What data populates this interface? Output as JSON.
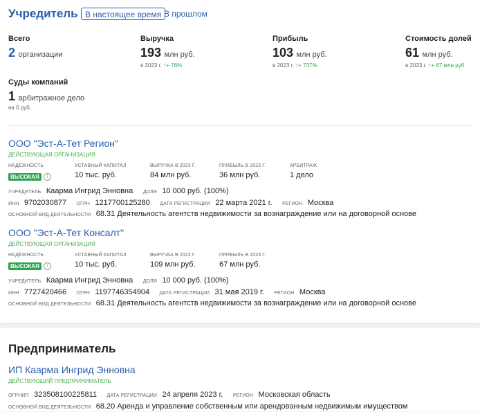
{
  "founder": {
    "title": "Учредитель",
    "tabs": [
      "В настоящее время",
      "В прошлом"
    ]
  },
  "summary": {
    "total": {
      "label": "Всего",
      "value": "2",
      "unit": "организации"
    },
    "revenue": {
      "label": "Выручка",
      "value": "193",
      "unit": "млн руб.",
      "year": "в 2023 г.",
      "change": "+ 76%"
    },
    "profit": {
      "label": "Прибыль",
      "value": "103",
      "unit": "млн руб.",
      "year": "в 2023 г.",
      "change": "+ 737%"
    },
    "share_value": {
      "label": "Стоимость долей",
      "value": "61",
      "unit": "млн руб.",
      "year": "в 2023 г.",
      "change": "+ 67 млн руб."
    },
    "courts": {
      "label": "Суды компаний",
      "value": "1",
      "unit": "арбитражное дело",
      "sub": "на 0 руб."
    }
  },
  "orgs": [
    {
      "name": "ООО \"Эст-А-Тет Регион\"",
      "status": "Действующая организация",
      "reliability_label": "Надёжность",
      "reliability": "Высокая",
      "capital_label": "Уставный капитал",
      "capital": "10 тыс. руб.",
      "revenue_label": "Выручка в 2023 г.",
      "revenue": "84 млн руб.",
      "profit_label": "Прибыль в 2023 г.",
      "profit": "36 млн руб.",
      "arb_label": "Арбитраж",
      "arb": "1 дело",
      "founder_label": "Учредитель",
      "founder": "Каарма Ингрид Энновна",
      "share_label": "Доля",
      "share": "10 000 руб. (100%)",
      "inn_label": "ИНН",
      "inn": "9702030877",
      "ogrn_label": "ОГРН",
      "ogrn": "1217700125280",
      "reg_label": "Дата регистрации",
      "reg": "22 марта 2021 г.",
      "region_label": "Регион",
      "region": "Москва",
      "activity_label": "Основной вид деятельности",
      "activity": "68.31 Деятельность агентств недвижимости за вознаграждение или на договорной основе"
    },
    {
      "name": "ООО \"Эст-А-Тет Консалт\"",
      "status": "Действующая организация",
      "reliability_label": "Надёжность",
      "reliability": "Высокая",
      "capital_label": "Уставный капитал",
      "capital": "10 тыс. руб.",
      "revenue_label": "Выручка в 2023 г.",
      "revenue": "109 млн руб.",
      "profit_label": "Прибыль в 2023 г.",
      "profit": "67 млн руб.",
      "founder_label": "Учредитель",
      "founder": "Каарма Ингрид Энновна",
      "share_label": "Доля",
      "share": "10 000 руб. (100%)",
      "inn_label": "ИНН",
      "inn": "7727420466",
      "ogrn_label": "ОГРН",
      "ogrn": "1197746354904",
      "reg_label": "Дата регистрации",
      "reg": "31 мая 2019 г.",
      "region_label": "Регион",
      "region": "Москва",
      "activity_label": "Основной вид деятельности",
      "activity": "68.31 Деятельность агентств недвижимости за вознаграждение или на договорной основе"
    }
  ],
  "entrepreneur": {
    "title": "Предприниматель",
    "name": "ИП Каарма Ингрид Энновна",
    "status": "Действующий предприниматель",
    "ogrnip_label": "ОГРНИП",
    "ogrnip": "323508100225811",
    "reg_label": "Дата регистрации",
    "reg": "24 апреля 2023 г.",
    "region_label": "Регион",
    "region": "Московская область",
    "activity_label": "Основной вид деятельности",
    "activity": "68.20 Аренда и управление собственным или арендованным недвижимым имуществом"
  },
  "icons": {
    "up_arrow": "↑",
    "info": "i"
  }
}
